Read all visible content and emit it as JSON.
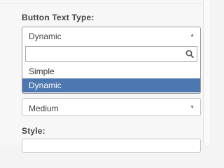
{
  "form": {
    "button_text_type_label": "Button Text Type:",
    "style_label": "Style:"
  },
  "button_text_type_select": {
    "selected": "Dynamic",
    "search_value": "",
    "options": [
      "Simple",
      "Dynamic"
    ],
    "highlighted": "Dynamic",
    "arrow_glyph": "▲"
  },
  "size_select": {
    "selected": "Medium",
    "arrow_glyph": "▼"
  },
  "style_select": {
    "selected": ""
  },
  "colors": {
    "highlight": "#4d77b1",
    "panel_background": "#f7f7f7"
  },
  "icons": {
    "search": "search-icon",
    "arrow_up": "arrow-up-icon",
    "arrow_down": "arrow-down-icon"
  }
}
